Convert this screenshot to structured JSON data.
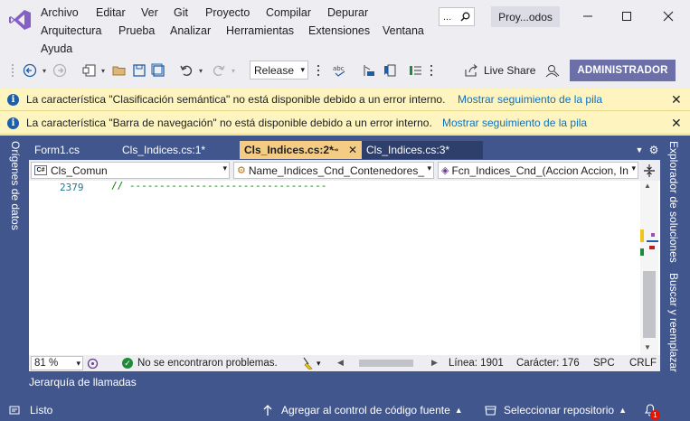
{
  "menu": {
    "items": [
      "Archivo",
      "Editar",
      "Ver",
      "Git",
      "Proyecto",
      "Compilar",
      "Depurar",
      "Arquitectura",
      "Prueba",
      "Analizar",
      "Herramientas",
      "Extensiones",
      "Ventana",
      "Ayuda"
    ]
  },
  "title": {
    "search_text": "...",
    "project_name": "Proy...odos"
  },
  "toolbar": {
    "configuration": "Release",
    "live_share": "Live Share",
    "admin_badge": "ADMINISTRADOR"
  },
  "infobars": [
    {
      "message": "La característica \"Clasificación semántica\" no está disponible debido a un error interno.",
      "link": "Mostrar seguimiento de la pila"
    },
    {
      "message": "La característica \"Barra de navegación\" no está disponible debido a un error interno.",
      "link": "Mostrar seguimiento de la pila"
    }
  ],
  "side_tabs": {
    "left": "Orígenes de datos",
    "right_top": "Explorador de soluciones",
    "right_bottom": "Buscar y reemplazar"
  },
  "doc_tabs": [
    {
      "label": "Form1.cs",
      "active": false
    },
    {
      "label": "Cls_Indices.cs:1*",
      "active": false
    },
    {
      "label": "Cls_Indices.cs:2*",
      "active": true
    },
    {
      "label": "Cls_Indices.cs:3*",
      "active": false
    }
  ],
  "navbar": {
    "project": "Cls_Comun",
    "type": "Name_Indices_Cnd_Contenedores_",
    "member": "Fcn_Indices_Cnd_(Accion Accion, In"
  },
  "editor": {
    "line_number": "2379",
    "code": "// ---------------------------------"
  },
  "editor_status": {
    "zoom": "81 %",
    "problems": "No se encontraron problemas.",
    "line": "Línea: 1901",
    "column": "Carácter: 176",
    "spacing": "SPC",
    "line_ending": "CRLF"
  },
  "bottom_tab": "Jerarquía de llamadas",
  "statusbar": {
    "state": "Listo",
    "source_control": "Agregar al control de código fuente",
    "repository": "Seleccionar repositorio",
    "notifications": "1"
  },
  "colors": {
    "accent": "#40568d",
    "active_tab": "#f5cc84",
    "infobar": "#fdf4bf",
    "link": "#0e70c0"
  }
}
